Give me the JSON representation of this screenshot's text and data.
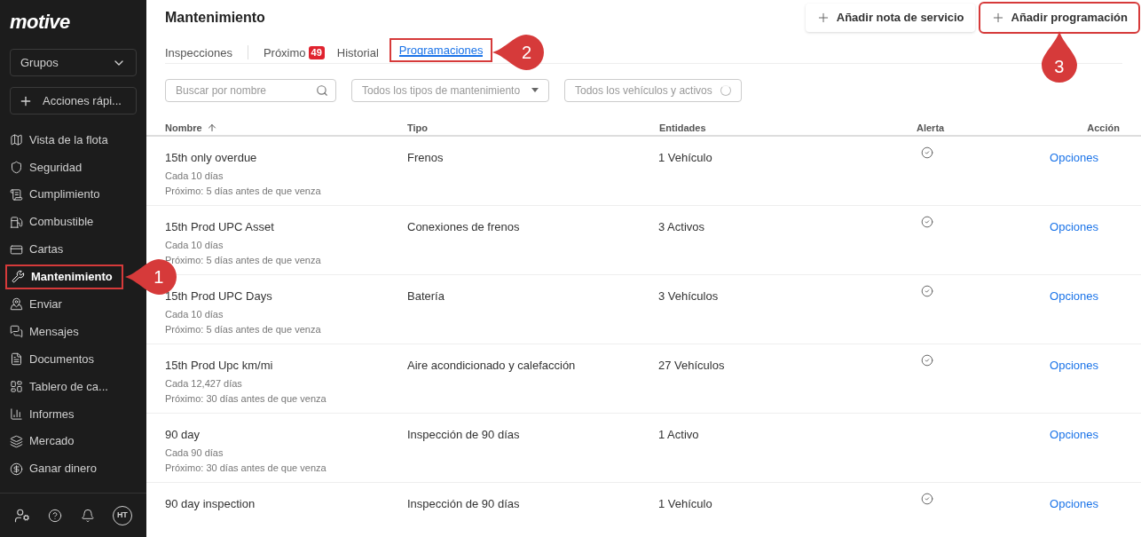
{
  "sidebar": {
    "logo": "motive",
    "groups_select": {
      "value": "Grupos"
    },
    "quick_actions": {
      "label": "Acciones rápi..."
    },
    "items": [
      {
        "label": "Vista de la flota",
        "selected": false
      },
      {
        "label": "Seguridad",
        "selected": false
      },
      {
        "label": "Cumplimiento",
        "selected": false
      },
      {
        "label": "Combustible",
        "selected": false
      },
      {
        "label": "Cartas",
        "selected": false
      },
      {
        "label": "Mantenimiento",
        "selected": true,
        "callout": "1"
      },
      {
        "label": "Enviar",
        "selected": false
      },
      {
        "label": "Mensajes",
        "selected": false
      },
      {
        "label": "Documentos",
        "selected": false
      },
      {
        "label": "Tablero de ca...",
        "selected": false
      },
      {
        "label": "Informes",
        "selected": false
      },
      {
        "label": "Mercado",
        "selected": false
      },
      {
        "label": "Ganar dinero",
        "selected": false
      }
    ],
    "avatar": "HT"
  },
  "page": {
    "title": "Mantenimiento",
    "buttons": [
      {
        "label": "Añadir nota de servicio"
      },
      {
        "label": "Añadir programación",
        "callout": "3"
      }
    ],
    "tabs": [
      {
        "label": "Inspecciones",
        "selected": false
      },
      {
        "label": "Próximo",
        "badge": "49",
        "selected": false
      },
      {
        "label": "Historial",
        "selected": false
      },
      {
        "label": "Programaciones",
        "selected": true,
        "callout": "2"
      }
    ],
    "filters": {
      "search": {
        "placeholder": "Buscar por nombre"
      },
      "type_select": {
        "placeholder": "Todos los tipos de mantenimiento"
      },
      "entity_select": {
        "placeholder": "Todos los vehículos y activos"
      }
    }
  },
  "table": {
    "columns": [
      "Nombre",
      "Tipo",
      "Entidades",
      "Alerta",
      "Acción"
    ],
    "rows": [
      {
        "name": "15th only overdue",
        "interval": "Cada 10 días",
        "next": "Próximo: 5 días antes de que venza",
        "type": "Frenos",
        "entities": "1 Vehículo",
        "alert": true,
        "action": "Opciones"
      },
      {
        "name": "15th Prod UPC Asset",
        "interval": "Cada 10 días",
        "next": "Próximo: 5 días antes de que venza",
        "type": "Conexiones de frenos",
        "entities": "3 Activos",
        "alert": true,
        "action": "Opciones"
      },
      {
        "name": "15th Prod UPC Days",
        "interval": "Cada 10 días",
        "next": "Próximo: 5 días antes de que venza",
        "type": "Batería",
        "entities": "3 Vehículos",
        "alert": true,
        "action": "Opciones"
      },
      {
        "name": "15th Prod Upc km/mi",
        "interval": "Cada 12,427 días",
        "next": "Próximo: 30 días antes de que venza",
        "type": "Aire acondicionado y calefacción",
        "entities": "27 Vehículos",
        "alert": true,
        "action": "Opciones"
      },
      {
        "name": "90 day",
        "interval": "Cada 90 días",
        "next": "Próximo: 30 días antes de que venza",
        "type": "Inspección de 90 días",
        "entities": "1 Activo",
        "alert": false,
        "action": "Opciones"
      },
      {
        "name": "90 day inspection",
        "type": "Inspección de 90 días",
        "entities": "1 Vehículo",
        "alert": true,
        "action": "Opciones"
      }
    ]
  }
}
